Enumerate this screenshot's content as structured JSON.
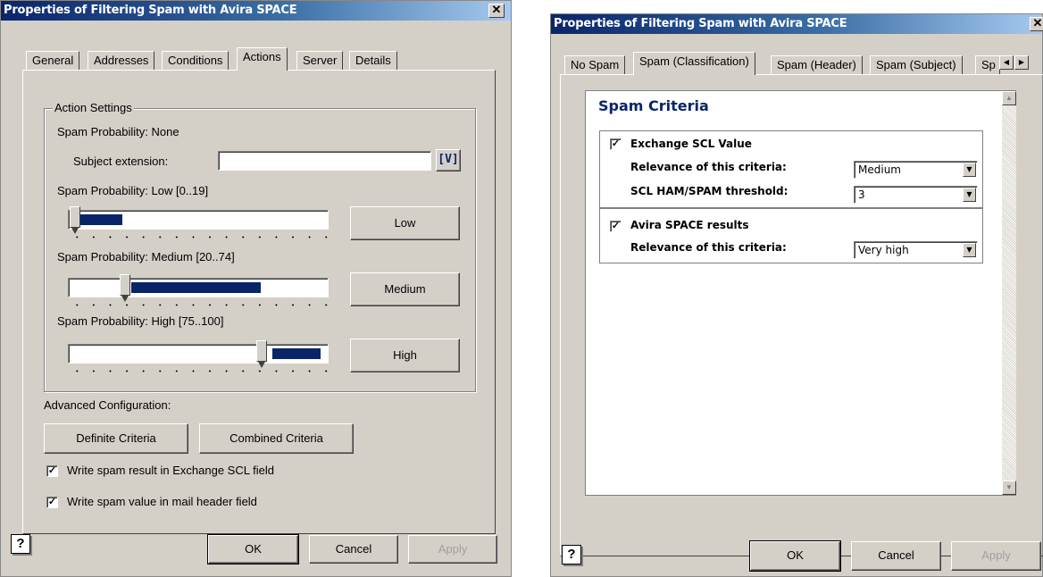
{
  "left_dialog": {
    "title": "Properties of Filtering Spam with Avira SPACE",
    "close_glyph": "✕",
    "tabs": [
      "General",
      "Addresses",
      "Conditions",
      "Actions",
      "Server",
      "Details"
    ],
    "active_tab": "Actions",
    "action_settings": {
      "legend": "Action Settings",
      "prob_none": "Spam Probability: None",
      "subject_extension_label": "Subject extension:",
      "subject_extension_value": "",
      "variable_button": "[V]",
      "prob_low": "Spam Probability: Low [0..19]",
      "prob_medium": "Spam Probability: Medium [20..74]",
      "prob_high": "Spam Probability: High [75..100]",
      "low_button": "Low",
      "medium_button": "Medium",
      "high_button": "High",
      "slider_low_value": 0.05,
      "slider_medium_value": 0.2,
      "slider_high_value": 0.75
    },
    "advanced_label": "Advanced Configuration:",
    "definite_button": "Definite Criteria",
    "combined_button": "Combined Criteria",
    "check_scl": "Write spam result in Exchange SCL field",
    "check_header": "Write spam value in mail header field",
    "check_scl_checked": true,
    "check_header_checked": true,
    "ok": "OK",
    "cancel": "Cancel",
    "apply": "Apply",
    "help_icon": "help-icon"
  },
  "right_dialog": {
    "title": "Properties of Filtering Spam with Avira SPACE",
    "close_glyph": "✕",
    "tabs": [
      "No Spam",
      "Spam (Classification)",
      "Spam (Header)",
      "Spam (Subject)",
      "Sp"
    ],
    "active_tab": "Spam (Classification)",
    "heading": "Spam Criteria",
    "exchange": {
      "label": "Exchange SCL Value",
      "checked": true,
      "relevance_label": "Relevance of this criteria:",
      "relevance_value": "Medium",
      "threshold_label": "SCL HAM/SPAM threshold:",
      "threshold_value": "3"
    },
    "avira": {
      "label": "Avira SPACE results",
      "checked": true,
      "relevance_label": "Relevance of this criteria:",
      "relevance_value": "Very high"
    },
    "ok": "OK",
    "cancel": "Cancel",
    "apply": "Apply",
    "help_icon": "help-icon"
  },
  "colors": {
    "title_gradient_start": "#0a246a",
    "title_gradient_end": "#a6caf0",
    "dialog_face": "#d4d0c8",
    "slider_fill": "#0a246a",
    "heading_blue": "#0a246a"
  }
}
